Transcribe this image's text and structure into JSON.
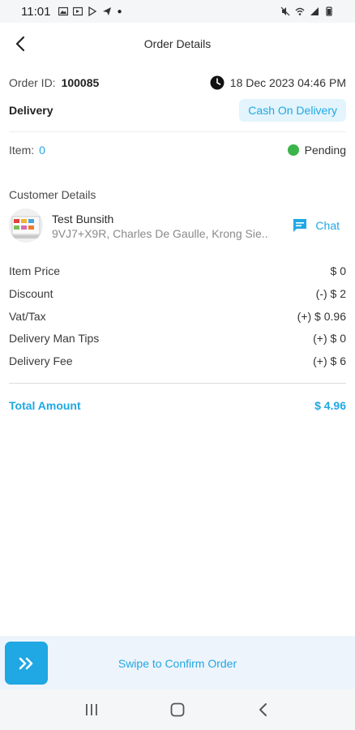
{
  "status_bar": {
    "time": "11:01"
  },
  "header": {
    "title": "Order Details"
  },
  "order": {
    "id_label": "Order ID:",
    "id_value": "100085",
    "date": "18 Dec 2023  04:46 PM",
    "delivery_type": "Delivery",
    "payment_method": "Cash On Delivery",
    "item_label": "Item:",
    "item_count": "0",
    "status": "Pending",
    "status_color": "#3bb54a"
  },
  "customer": {
    "section_title": "Customer Details",
    "name": "Test Bunsith",
    "address": "9VJ7+X9R, Charles De Gaulle, Krong Sie...",
    "chat_label": "Chat"
  },
  "pricing": {
    "rows": [
      {
        "label": "Item Price",
        "value": "$ 0"
      },
      {
        "label": "Discount",
        "value": "(-) $ 2"
      },
      {
        "label": "Vat/Tax",
        "value": "(+) $ 0.96"
      },
      {
        "label": "Delivery Man Tips",
        "value": "(+) $ 0"
      },
      {
        "label": "Delivery Fee",
        "value": "(+) $ 6"
      }
    ],
    "total_label": "Total Amount",
    "total_value": "$ 4.96"
  },
  "action": {
    "swipe_label": "Swipe to Confirm Order"
  },
  "theme": {
    "accent": "#1fa8e3",
    "badge_bg": "#e3f4fc"
  },
  "icons": {
    "back": "arrow-left-icon",
    "clock": "clock-icon",
    "chat": "chat-icon",
    "swipe": "double-chevron-right-icon",
    "nav_recent": "recent-apps-icon",
    "nav_home": "home-icon",
    "nav_back": "back-icon"
  }
}
